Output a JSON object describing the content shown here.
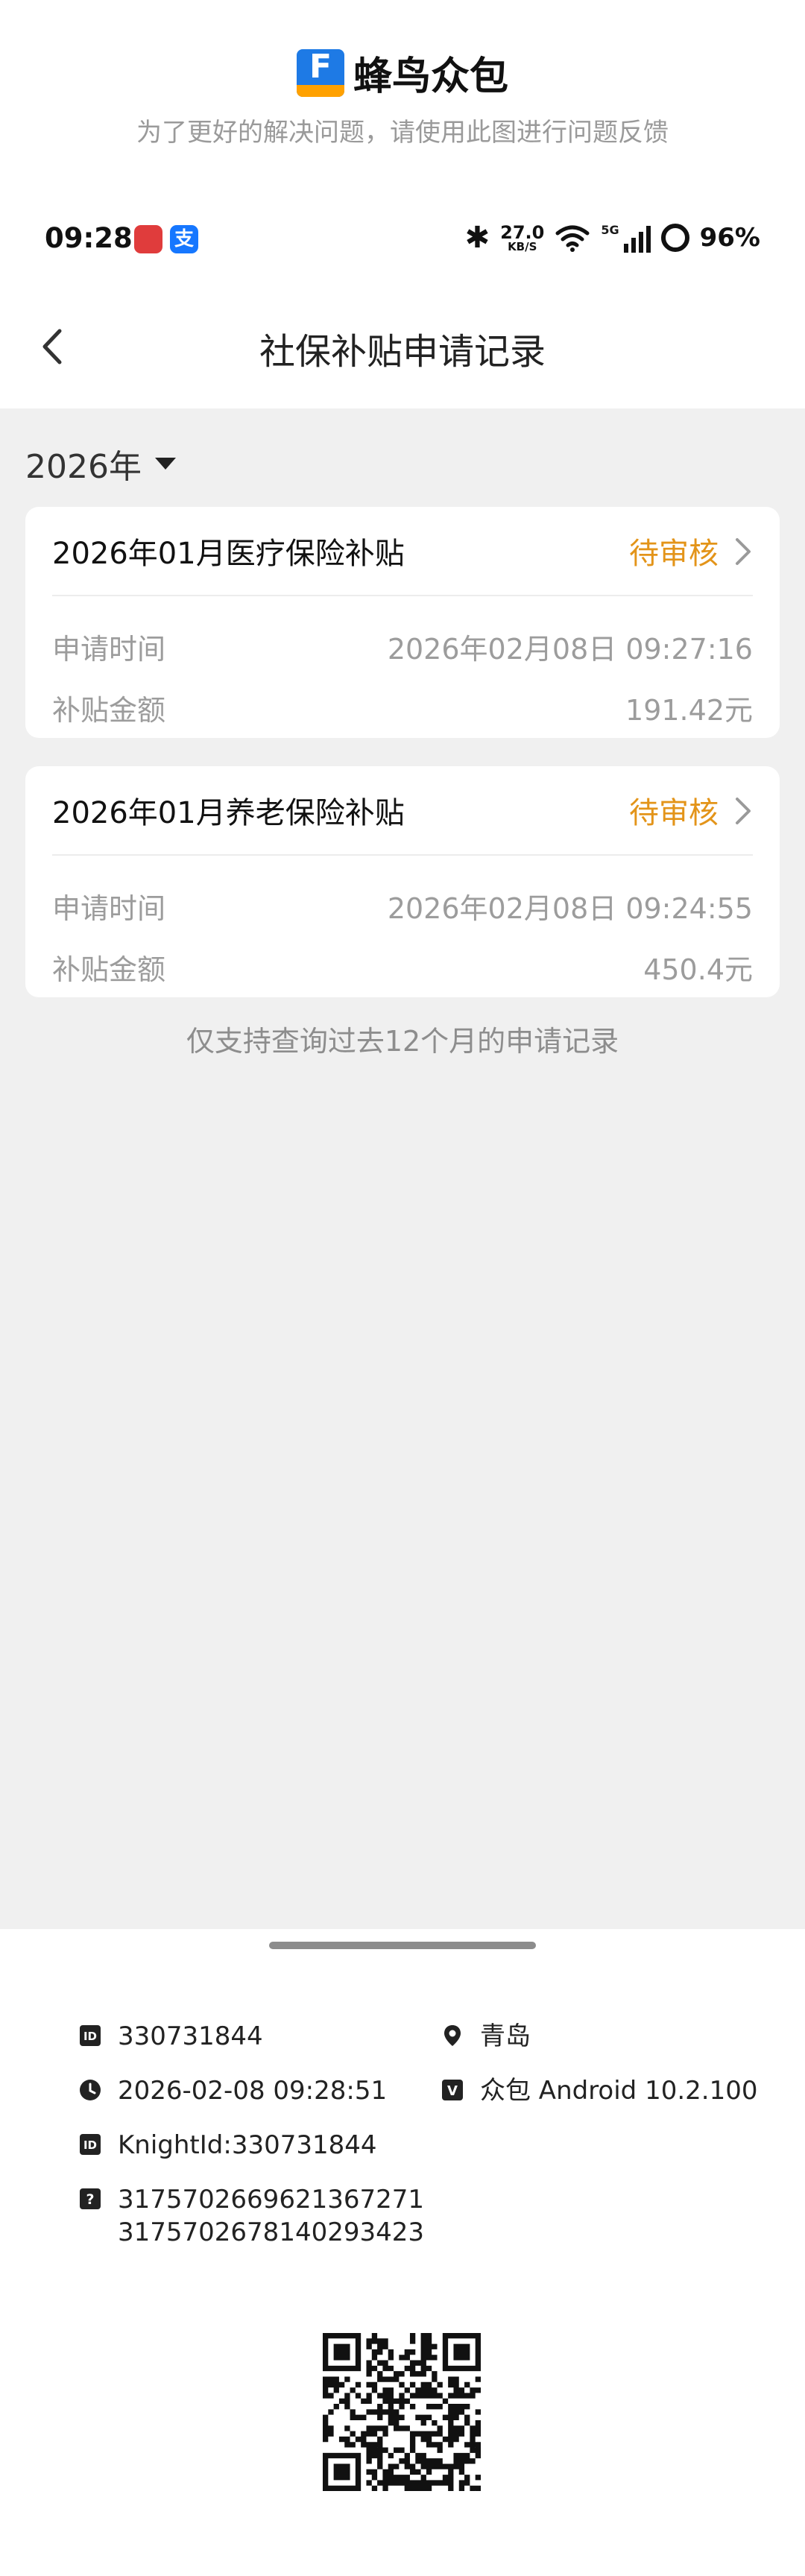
{
  "banner": {
    "app_name": "蜂鸟众包",
    "logo_glyph": "F",
    "subtitle": "为了更好的解决问题，请使用此图进行问题反馈"
  },
  "status_bar": {
    "time": "09:28",
    "app2_glyph": "支",
    "net_speed_value": "27.0",
    "net_speed_unit": "KB/S",
    "network_tag": "5G",
    "battery_percent": "96%"
  },
  "header": {
    "title": "社保补贴申请记录"
  },
  "filter": {
    "year": "2026年"
  },
  "records": [
    {
      "title": "2026年01月医疗保险补贴",
      "status": "待审核",
      "apply_time_label": "申请时间",
      "apply_time": "2026年02月08日 09:27:16",
      "amount_label": "补贴金额",
      "amount": "191.42元"
    },
    {
      "title": "2026年01月养老保险补贴",
      "status": "待审核",
      "apply_time_label": "申请时间",
      "apply_time": "2026年02月08日 09:24:55",
      "amount_label": "补贴金额",
      "amount": "450.4元"
    }
  ],
  "footnote": "仅支持查询过去12个月的申请记录",
  "info": {
    "user_id": "330731844",
    "city": "青岛",
    "timestamp": "2026-02-08 09:28:51",
    "version": "众包 Android 10.2.100",
    "knight_id": "KnightId:330731844",
    "trace_id_1": "3175702669621367271",
    "trace_id_2": "3175702678140293423"
  },
  "colors": {
    "status_pending": "#e39419",
    "page_bg": "#f0f0f0",
    "brand_blue": "#1e7ae5",
    "brand_orange": "#ffa100"
  },
  "icons": [
    "back-arrow-icon",
    "dropdown-caret-icon",
    "chevron-right-icon",
    "id-icon",
    "location-pin-icon",
    "clock-icon",
    "version-icon",
    "question-icon",
    "qr-code"
  ]
}
